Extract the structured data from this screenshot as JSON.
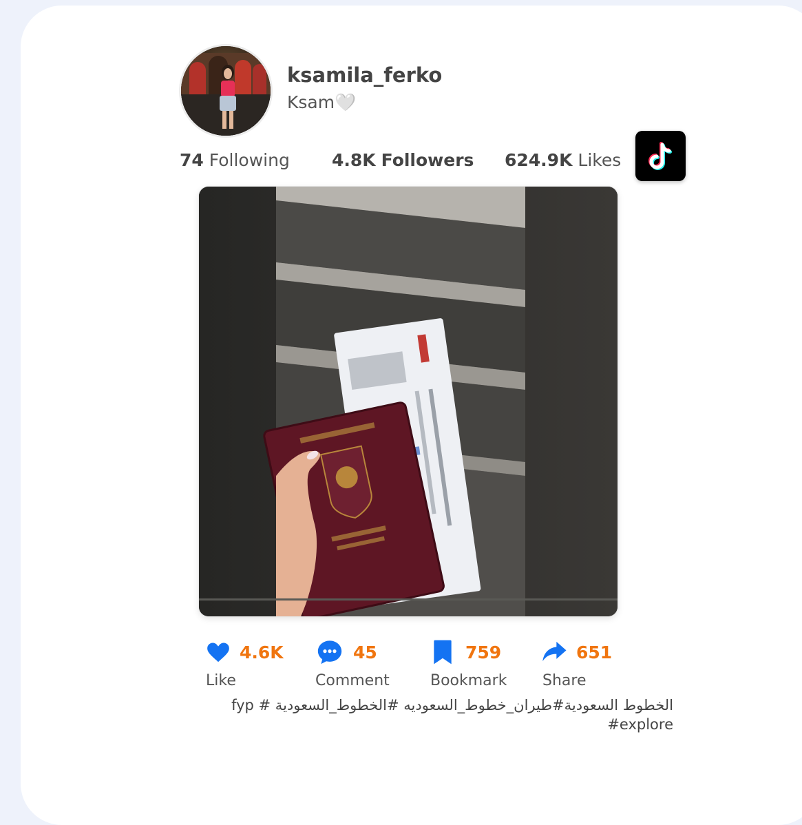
{
  "profile": {
    "username": "ksamila_ferko",
    "nickname": "Ksam🤍",
    "avatar_icon": "profile-photo"
  },
  "stats": {
    "following_count": "74",
    "following_label": "Following",
    "followers_count": "4.8K",
    "followers_label": "Followers",
    "likes_count": "624.9K",
    "likes_label": "Likes"
  },
  "brand": {
    "logo_icon": "tiktok-logo-icon",
    "accent_color": "#f0750f",
    "icon_color": "#1473f2"
  },
  "video": {
    "thumbnail_icon": "video-thumbnail"
  },
  "actions": [
    {
      "icon": "heart-icon",
      "count": "4.6K",
      "label": "Like"
    },
    {
      "icon": "comment-icon",
      "count": "45",
      "label": "Comment"
    },
    {
      "icon": "bookmark-icon",
      "count": "759",
      "label": "Bookmark"
    },
    {
      "icon": "share-icon",
      "count": "651",
      "label": "Share"
    }
  ],
  "caption": "الخطوط السعودية#طيران_خطوط_السعوديه #الخطوط_السعودية # fyp #explore"
}
